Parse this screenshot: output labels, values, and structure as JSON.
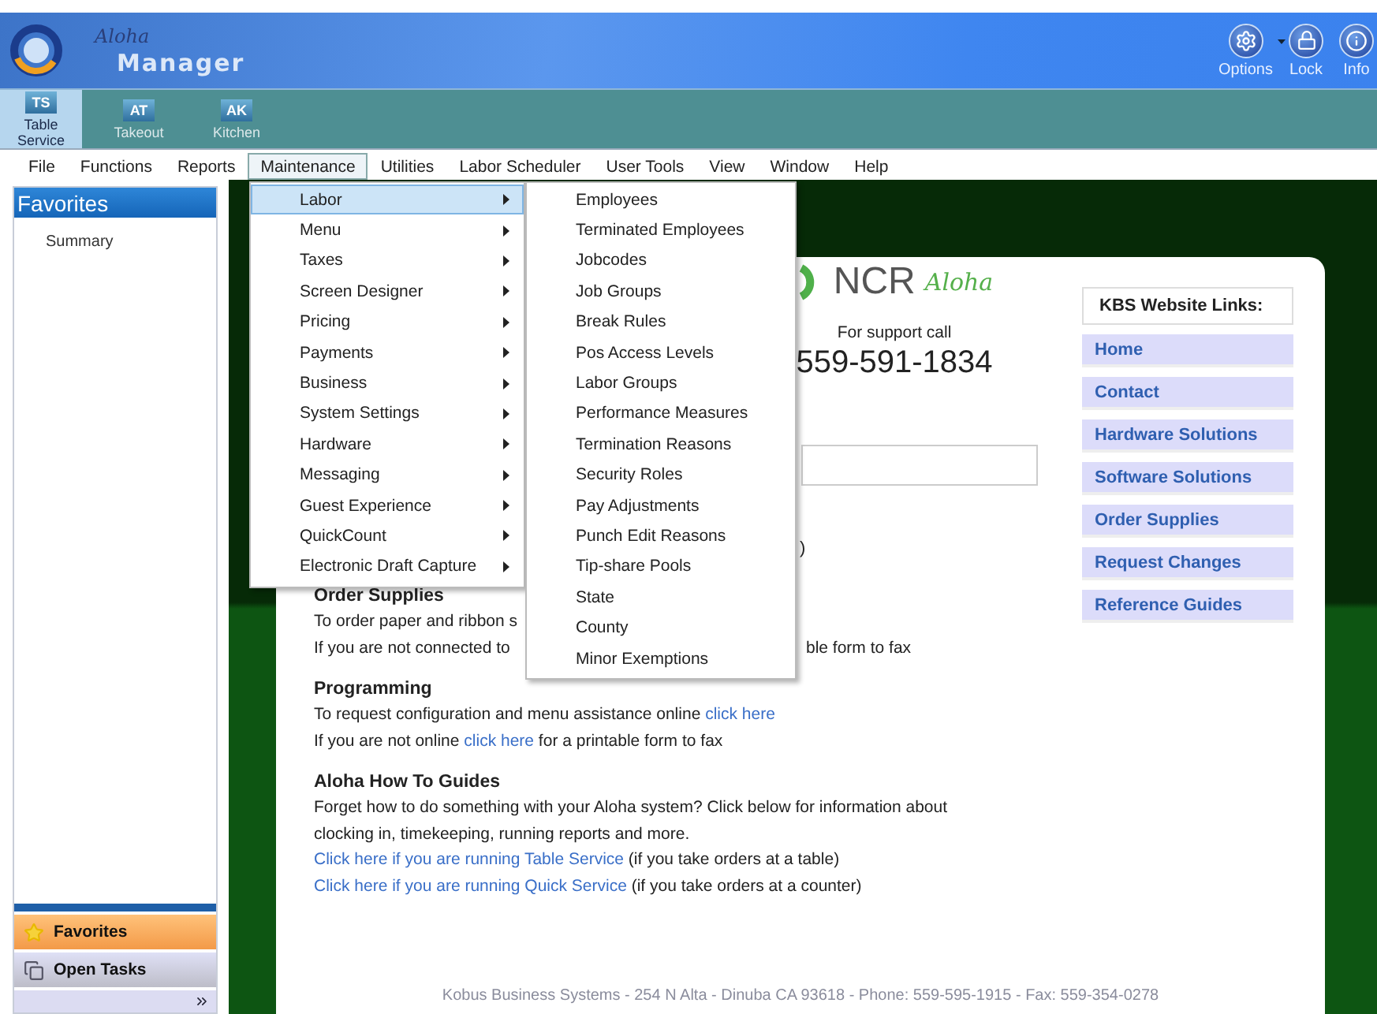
{
  "app": {
    "logo_script": "Aloha",
    "logo_title": "Manager"
  },
  "header_actions": [
    {
      "label": "Options",
      "kind": "options"
    },
    {
      "label": "Lock",
      "kind": "lock"
    },
    {
      "label": "Info",
      "kind": "info"
    }
  ],
  "quick_buttons": [
    {
      "code": "TS",
      "label": "Table Service",
      "selected": true
    },
    {
      "code": "AT",
      "label": "Takeout",
      "selected": false
    },
    {
      "code": "AK",
      "label": "Kitchen",
      "selected": false
    }
  ],
  "menu_bar": [
    {
      "label": "File",
      "selected": false
    },
    {
      "label": "Functions",
      "selected": false
    },
    {
      "label": "Reports",
      "selected": false
    },
    {
      "label": "Maintenance",
      "selected": true
    },
    {
      "label": "Utilities",
      "selected": false
    },
    {
      "label": "Labor Scheduler",
      "selected": false
    },
    {
      "label": "User Tools",
      "selected": false
    },
    {
      "label": "View",
      "selected": false
    },
    {
      "label": "Window",
      "selected": false
    },
    {
      "label": "Help",
      "selected": false
    }
  ],
  "open_menu": {
    "items": [
      {
        "label": "Labor",
        "selected": true
      },
      {
        "label": "Menu",
        "selected": false
      },
      {
        "label": "Taxes",
        "selected": false
      },
      {
        "label": "Screen Designer",
        "selected": false
      },
      {
        "label": "Pricing",
        "selected": false
      },
      {
        "label": "Payments",
        "selected": false
      },
      {
        "label": "Business",
        "selected": false
      },
      {
        "label": "System Settings",
        "selected": false
      },
      {
        "label": "Hardware",
        "selected": false
      },
      {
        "label": "Messaging",
        "selected": false
      },
      {
        "label": "Guest Experience",
        "selected": false
      },
      {
        "label": "QuickCount",
        "selected": false
      },
      {
        "label": "Electronic Draft Capture",
        "selected": false
      }
    ]
  },
  "submenu": {
    "items": [
      "Employees",
      "Terminated Employees",
      "Jobcodes",
      "Job Groups",
      "Break Rules",
      "Pos Access Levels",
      "Labor Groups",
      "Performance Measures",
      "Termination Reasons",
      "Security Roles",
      "Pay Adjustments",
      "Punch Edit Reasons",
      "Tip-share Pools",
      "State",
      "County",
      "Minor Exemptions"
    ]
  },
  "sidebar": {
    "title": "Favorites",
    "items": [
      "Summary"
    ],
    "nav": [
      {
        "label": "Favorites",
        "kind": "favorites",
        "selected": true
      },
      {
        "label": "Open Tasks",
        "kind": "tasks",
        "selected": false
      }
    ]
  },
  "content": {
    "brand": {
      "name": "NCR",
      "script": "Aloha"
    },
    "support_label": "For support call",
    "support_phone": "559-591-1834",
    "fragment": ")",
    "sections": [
      {
        "heading": "Order Supplies",
        "lines": [
          {
            "parts": [
              [
                {
                  "kind": "text",
                  "text": "To order paper and ribbon s"
                }
              ]
            ]
          },
          {
            "after_menu": true,
            "parts": [
              [
                {
                  "kind": "text",
                  "text": "If you are not connected to"
                }
              ],
              [
                {
                  "kind": "text",
                  "text": "ble form to fax"
                }
              ]
            ]
          }
        ]
      },
      {
        "heading": "Programming",
        "lines": [
          {
            "parts": [
              [
                {
                  "kind": "text",
                  "text": "To request configuration and menu assistance online "
                },
                {
                  "kind": "link",
                  "text": "click here"
                }
              ]
            ]
          },
          {
            "parts": [
              [
                {
                  "kind": "text",
                  "text": "If you are not online "
                },
                {
                  "kind": "link",
                  "text": "click here"
                },
                {
                  "kind": "text",
                  "text": " for a printable form to fax"
                }
              ]
            ]
          }
        ]
      },
      {
        "heading": "Aloha How To Guides",
        "lines": [
          {
            "parts": [
              [
                {
                  "kind": "text",
                  "text": "Forget how to do something with your Aloha system? Click below for information about"
                }
              ]
            ]
          },
          {
            "parts": [
              [
                {
                  "kind": "text",
                  "text": "clocking in, timekeeping, running reports and more."
                }
              ]
            ]
          },
          {
            "parts": [
              [
                {
                  "kind": "link",
                  "text": "Click here if you are running Table Service"
                },
                {
                  "kind": "text",
                  "text": " (if you take orders at a table)"
                }
              ]
            ]
          },
          {
            "parts": [
              [
                {
                  "kind": "link",
                  "text": "Click here if you are running Quick Service"
                },
                {
                  "kind": "text",
                  "text": " (if you take orders at a counter)"
                }
              ]
            ]
          }
        ]
      }
    ],
    "links_title": "KBS Website Links:",
    "links": [
      "Home",
      "Contact",
      "Hardware Solutions",
      "Software Solutions",
      "Order Supplies",
      "Request Changes",
      "Reference Guides"
    ],
    "footer": "Kobus Business Systems - 254 N Alta - Dinuba CA 93618 - Phone: 559-595-1915 - Fax: 559-354-0278"
  }
}
